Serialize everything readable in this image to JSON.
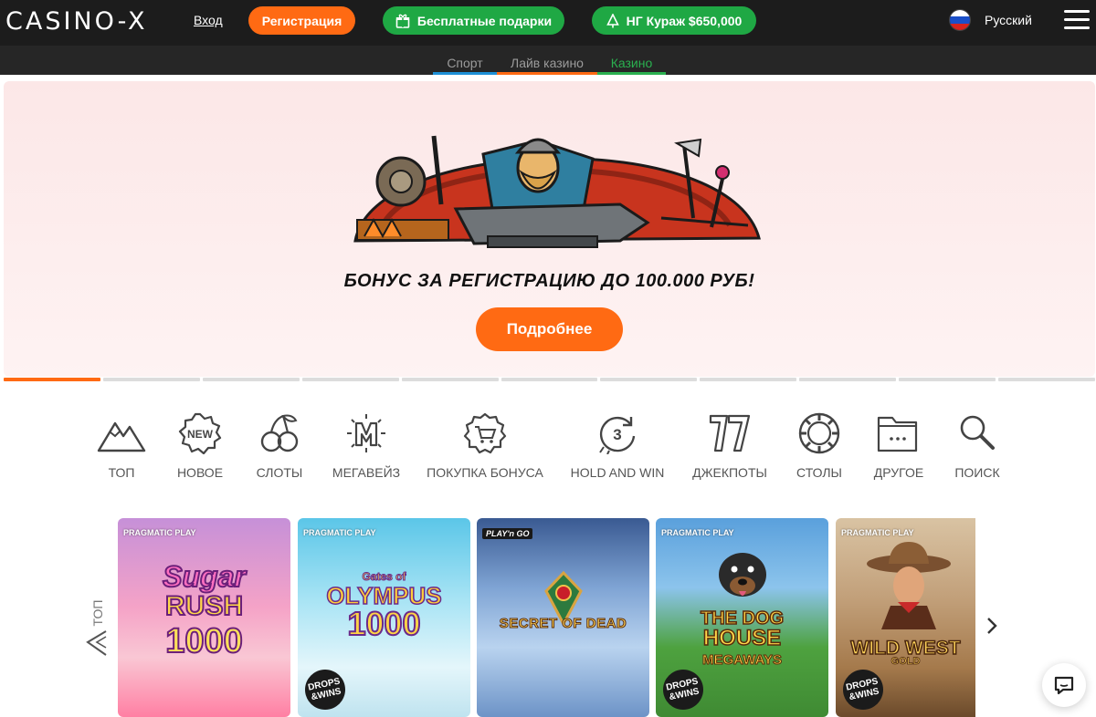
{
  "header": {
    "logo": "CASINO-X",
    "login_label": "Вход",
    "register_label": "Регистрация",
    "gifts_label": "Бесплатные подарки",
    "ng_label": "НГ Кураж $650,000",
    "language_label": "Русский",
    "flag_icon": "russia-flag-icon",
    "menu_icon": "hamburger-menu-icon"
  },
  "section_tabs": [
    {
      "label": "Спорт",
      "underline_color": "#1e90d6"
    },
    {
      "label": "Лайв казино",
      "underline_color": "#ff6a13"
    },
    {
      "label": "Казино",
      "underline_color": "#2ab04f",
      "active": true
    }
  ],
  "banner": {
    "title": "БОНУС ЗА РЕГИСТРАЦИЮ ДО 100.000 РУБ!",
    "button_label": "Подробнее",
    "slide_count": 11,
    "active_slide": 1
  },
  "categories": [
    {
      "label": "ТОП",
      "icon": "mountain-icon"
    },
    {
      "label": "НОВОЕ",
      "icon": "new-badge-icon"
    },
    {
      "label": "СЛОТЫ",
      "icon": "cherries-icon"
    },
    {
      "label": "МЕГАВЕЙЗ",
      "icon": "megaways-icon"
    },
    {
      "label": "ПОКУПКА БОНУСА",
      "icon": "shopping-cart-icon"
    },
    {
      "label": "HOLD AND WIN",
      "icon": "respin-3-icon"
    },
    {
      "label": "ДЖЕКПОТЫ",
      "icon": "lucky-seven-icon"
    },
    {
      "label": "СТОЛЫ",
      "icon": "poker-chip-icon"
    },
    {
      "label": "ДРУГОЕ",
      "icon": "folder-icon"
    },
    {
      "label": "ПОИСК",
      "icon": "search-icon"
    }
  ],
  "games_section": {
    "side_label": "ТОП",
    "side_icon": "mountain-icon",
    "next_icon": "chevron-right-icon",
    "games": [
      {
        "provider": "PRAGMATIC PLAY",
        "title_line1": "Sugar",
        "title_line2": "RUSH",
        "title_line3": "1000",
        "drops_wins": false
      },
      {
        "provider": "PRAGMATIC PLAY",
        "title_line1": "Gates of",
        "title_line2": "OLYMPUS",
        "title_line3": "1000",
        "drops_wins": true
      },
      {
        "provider": "PLAY'n GO",
        "title_line1": "SECRET OF DEAD",
        "title_line2": "",
        "title_line3": "",
        "drops_wins": false
      },
      {
        "provider": "PRAGMATIC PLAY",
        "title_line1": "THE DOG",
        "title_line2": "HOUSE",
        "title_line3": "MEGAWAYS",
        "drops_wins": true
      },
      {
        "provider": "PRAGMATIC PLAY",
        "title_line1": "WILD WEST",
        "title_line2": "GOLD",
        "title_line3": "",
        "drops_wins": true
      }
    ],
    "drops_label_1": "DROPS",
    "drops_label_2": "&WINS"
  },
  "chat": {
    "icon": "chat-bubble-icon"
  },
  "colors": {
    "accent_orange": "#ff6a13",
    "accent_green": "#1fa844",
    "header_bg": "#1c1c1c"
  }
}
